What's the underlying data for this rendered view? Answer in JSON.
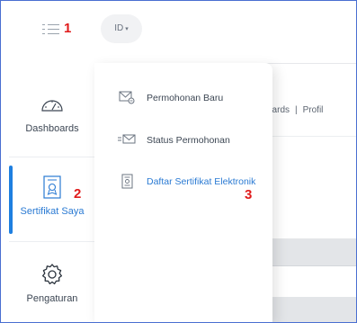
{
  "topbar": {
    "language": "ID",
    "markers": {
      "menu": "1",
      "sidebar": "2",
      "submenu": "3"
    }
  },
  "breadcrumb": {
    "items": [
      "oards",
      "Profil"
    ],
    "separator": "|"
  },
  "sidebar": {
    "items": [
      {
        "label": "Dashboards",
        "icon": "speedometer-icon"
      },
      {
        "label": "Sertifikat Saya",
        "icon": "certificate-icon",
        "active": true
      },
      {
        "label": "Pengaturan",
        "icon": "gear-icon"
      }
    ]
  },
  "submenu": {
    "items": [
      {
        "label": "Permohonan Baru",
        "icon": "envelope-plus-icon"
      },
      {
        "label": "Status Permohonan",
        "icon": "envelope-status-icon"
      },
      {
        "label": "Daftar Sertifikat Elektronik",
        "icon": "certificate-list-icon",
        "highlighted": true
      }
    ]
  },
  "colors": {
    "accent": "#2a7ad3",
    "active_bar": "#1e7fe0",
    "marker": "#e01b1b",
    "band": "#e3e5e8"
  }
}
